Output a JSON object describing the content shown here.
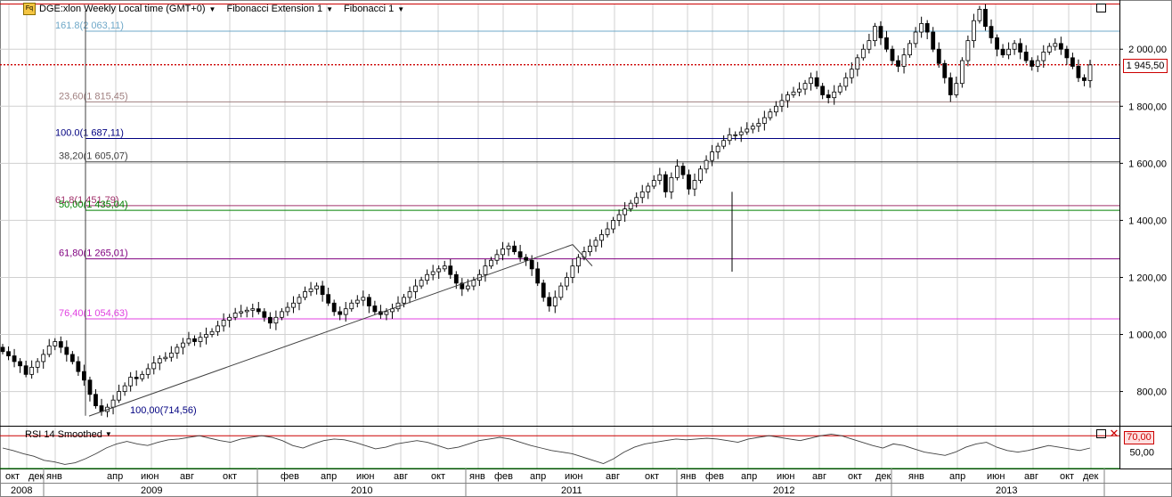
{
  "header": {
    "icon": "chart-window-icon",
    "title": "DGE:xlon Weekly Local time (GMT+0)",
    "indicators": [
      "Fibonacci Extension 1",
      "Fibonacci 1"
    ]
  },
  "rsi_panel": {
    "title": "RSI 14 Smoothed",
    "badge_value": "70,00",
    "close_icon": "close-icon",
    "maximize_icon": "maximize-icon"
  },
  "current_price": "1 945,50",
  "colors": {
    "bull_candle": "#ffffff",
    "bear_candle": "#000000",
    "current_price_line": "#cc0000",
    "fib_161_8": "#6fa8c8",
    "fib_100": "#000080",
    "fib_23_6": "#a08080",
    "fib_38_2": "#404040",
    "fib_50": "#008000",
    "fib_61_8_ext": "#a0306a",
    "fib_61_8": "#800080",
    "fib_76_4": "#e040e0",
    "rsi_line": "#404040",
    "rsi_band_70": "#cc0000",
    "rsi_band_30": "#008000"
  },
  "chart_data": [
    {
      "type": "candlestick",
      "title": "DGE:xlon Weekly",
      "ylim": [
        680,
        2160
      ],
      "y_ticks": [
        "800,00",
        "1 000,00",
        "1 200,00",
        "1 400,00",
        "1 600,00",
        "1 800,00",
        "2 000,00"
      ],
      "y_tick_values": [
        800,
        1000,
        1200,
        1400,
        1600,
        1800,
        2000
      ],
      "x_month_labels": [
        "окт",
        "дек",
        "янв",
        "апр",
        "июн",
        "авг",
        "окт",
        "фев",
        "апр",
        "июн",
        "авг",
        "окт",
        "янв",
        "фев",
        "апр",
        "июн",
        "авг",
        "окт",
        "янв",
        "фев",
        "апр",
        "июн",
        "авг",
        "окт",
        "дек",
        "янв",
        "апр",
        "июн",
        "авг",
        "окт",
        "дек"
      ],
      "x_year_labels": [
        "2008",
        "2009",
        "2010",
        "2011",
        "2012",
        "2013"
      ],
      "fib_levels": [
        {
          "label": "161.8(2 063,11)",
          "value": 2063.11,
          "color_key": "fib_161_8"
        },
        {
          "label": "23,60(1 815,45)",
          "value": 1815.45,
          "color_key": "fib_23_6"
        },
        {
          "label": "100.0(1 687,11)",
          "value": 1687.11,
          "color_key": "fib_100"
        },
        {
          "label": "38,20(1 605,07)",
          "value": 1605.07,
          "color_key": "fib_38_2"
        },
        {
          "label": "61.8(1 451,79)",
          "value": 1451.79,
          "color_key": "fib_61_8_ext"
        },
        {
          "label": "50,00(1 435,04)",
          "value": 1435.04,
          "color_key": "fib_50"
        },
        {
          "label": "61,80(1 265,01)",
          "value": 1265.01,
          "color_key": "fib_61_8"
        },
        {
          "label": "76,40(1 054,63)",
          "value": 1054.63,
          "color_key": "fib_76_4"
        },
        {
          "label": "100,00(714,56)",
          "value": 714.56,
          "color_key": "fib_100"
        }
      ],
      "current_price_value": 1945.5,
      "close_series": [
        940,
        925,
        905,
        890,
        860,
        885,
        905,
        930,
        960,
        975,
        955,
        930,
        905,
        870,
        840,
        790,
        750,
        730,
        745,
        770,
        800,
        820,
        850,
        845,
        860,
        880,
        900,
        915,
        920,
        935,
        955,
        970,
        985,
        975,
        990,
        1000,
        1010,
        1030,
        1050,
        1060,
        1075,
        1080,
        1085,
        1090,
        1080,
        1060,
        1040,
        1060,
        1080,
        1095,
        1110,
        1130,
        1150,
        1160,
        1170,
        1140,
        1110,
        1080,
        1070,
        1090,
        1110,
        1120,
        1130,
        1100,
        1080,
        1070,
        1080,
        1090,
        1110,
        1130,
        1150,
        1170,
        1190,
        1210,
        1220,
        1230,
        1240,
        1210,
        1180,
        1160,
        1170,
        1190,
        1210,
        1240,
        1260,
        1280,
        1300,
        1310,
        1290,
        1270,
        1260,
        1230,
        1180,
        1130,
        1100,
        1130,
        1170,
        1200,
        1240,
        1270,
        1290,
        1310,
        1330,
        1350,
        1370,
        1400,
        1420,
        1440,
        1460,
        1480,
        1500,
        1520,
        1540,
        1560,
        1500,
        1550,
        1590,
        1560,
        1510,
        1540,
        1580,
        1610,
        1640,
        1660,
        1680,
        1700,
        1700,
        1710,
        1720,
        1730,
        1740,
        1760,
        1780,
        1800,
        1820,
        1840,
        1850,
        1860,
        1880,
        1900,
        1870,
        1840,
        1830,
        1850,
        1870,
        1900,
        1930,
        1970,
        2000,
        2030,
        2080,
        2040,
        2000,
        1960,
        1940,
        1980,
        2020,
        2060,
        2090,
        2060,
        2000,
        1950,
        1900,
        1840,
        1880,
        1960,
        2030,
        2100,
        2140,
        2080,
        2040,
        2000,
        1980,
        2000,
        2020,
        1990,
        1960,
        1940,
        1960,
        1990,
        2010,
        2020,
        2000,
        1970,
        1940,
        1900,
        1890,
        1945
      ],
      "close_series_unit": "GBX, approximate weekly closes"
    },
    {
      "type": "line",
      "title": "RSI 14 Smoothed",
      "ylim": [
        30,
        80
      ],
      "y_ticks": [
        "50,00"
      ],
      "y_tick_values": [
        50
      ],
      "bands": [
        70,
        30
      ],
      "series": [
        {
          "name": "RSI 14 Smoothed",
          "values": [
            55,
            52,
            48,
            45,
            40,
            38,
            35,
            37,
            42,
            48,
            55,
            60,
            63,
            60,
            58,
            62,
            65,
            66,
            68,
            70,
            67,
            64,
            62,
            66,
            68,
            70,
            68,
            64,
            58,
            55,
            60,
            64,
            66,
            65,
            62,
            58,
            54,
            56,
            60,
            62,
            64,
            62,
            58,
            54,
            56,
            60,
            64,
            66,
            68,
            66,
            62,
            58,
            55,
            52,
            50,
            48,
            44,
            40,
            36,
            42,
            50,
            56,
            60,
            62,
            64,
            66,
            65,
            66,
            67,
            66,
            64,
            62,
            66,
            68,
            70,
            68,
            66,
            64,
            67,
            70,
            72,
            70,
            66,
            62,
            58,
            55,
            60,
            58,
            54,
            50,
            48,
            46,
            50,
            56,
            60,
            62,
            56,
            52,
            50,
            52,
            55,
            58,
            56,
            54,
            52,
            55
          ]
        }
      ]
    }
  ]
}
